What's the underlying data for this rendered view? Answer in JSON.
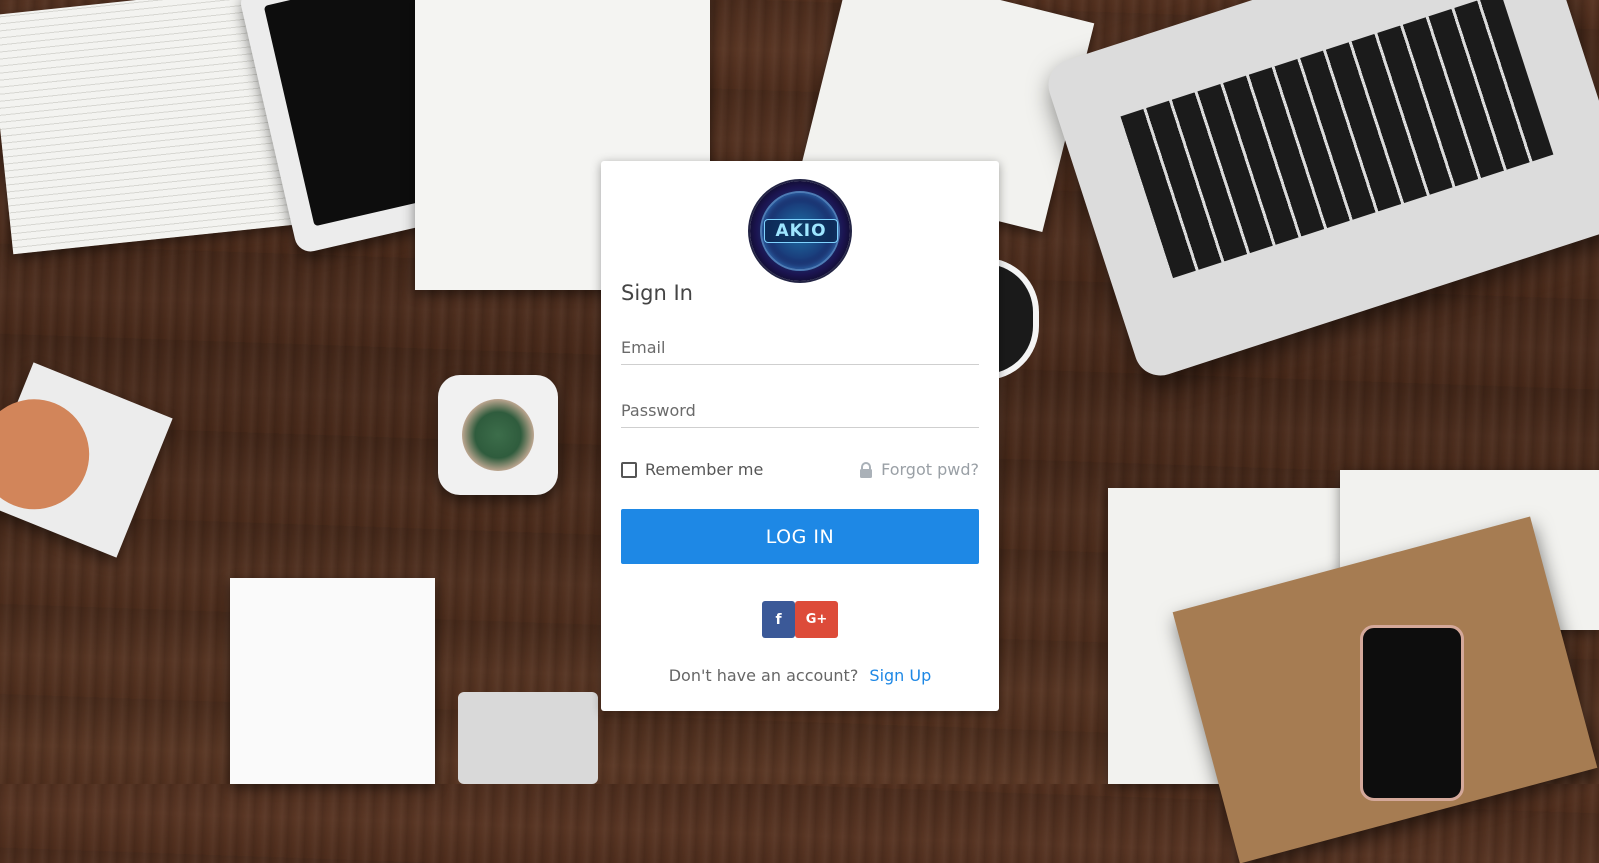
{
  "logo": {
    "text": "AKIO"
  },
  "signin": {
    "title": "Sign In"
  },
  "form": {
    "email_placeholder": "Email",
    "password_placeholder": "Password",
    "remember_label": "Remember me",
    "forgot_label": "Forgot pwd?",
    "login_label": "LOG IN"
  },
  "social": {
    "facebook": "f",
    "googleplus": "G+"
  },
  "footer": {
    "prompt": "Don't have an account?",
    "signup_label": "Sign Up"
  },
  "colors": {
    "primary": "#1e88e5",
    "facebook": "#3b5998",
    "google": "#dd4b39"
  },
  "icons": [
    "lock-icon",
    "facebook-icon",
    "google-plus-icon"
  ]
}
